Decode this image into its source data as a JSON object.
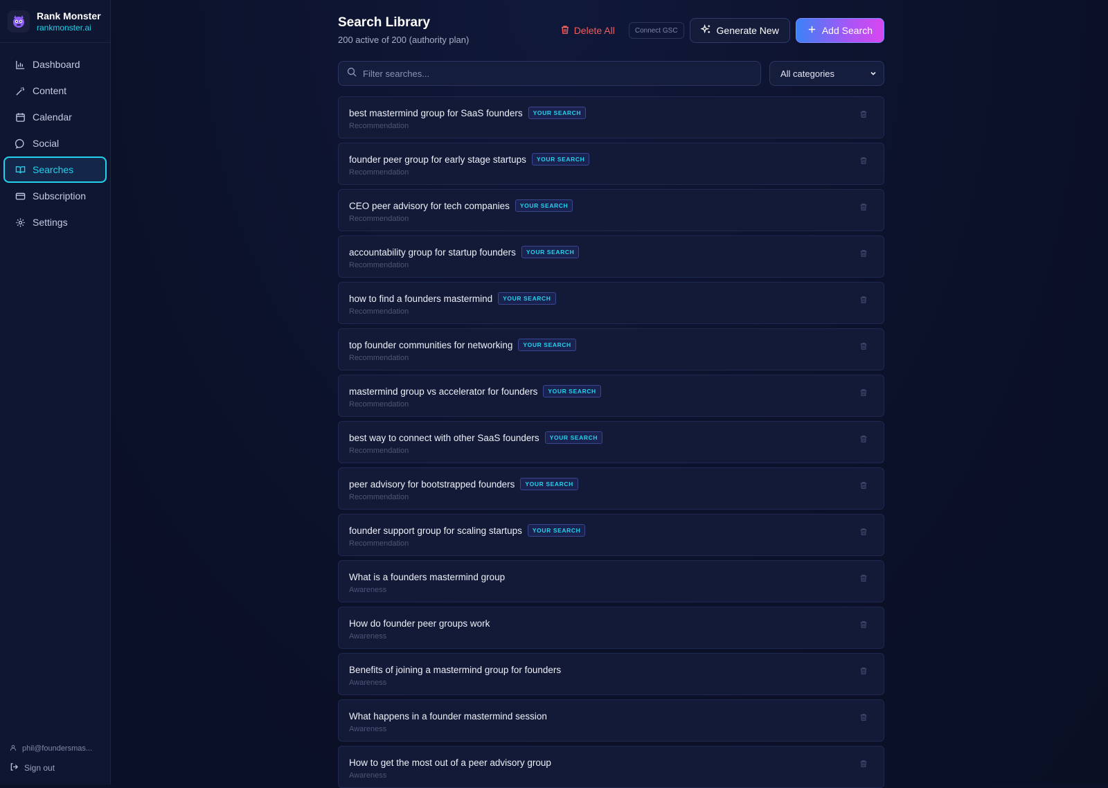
{
  "brand": {
    "name": "Rank Monster",
    "url": "rankmonster.ai",
    "logo_icon": "monster-logo-icon"
  },
  "nav": {
    "items": [
      {
        "label": "Dashboard",
        "icon": "bar-chart-icon",
        "active": false
      },
      {
        "label": "Content",
        "icon": "magic-wand-icon",
        "active": false
      },
      {
        "label": "Calendar",
        "icon": "calendar-icon",
        "active": false
      },
      {
        "label": "Social",
        "icon": "chat-bubble-icon",
        "active": false
      },
      {
        "label": "Searches",
        "icon": "book-icon",
        "active": true
      },
      {
        "label": "Subscription",
        "icon": "credit-card-icon",
        "active": false
      },
      {
        "label": "Settings",
        "icon": "gear-icon",
        "active": false
      }
    ]
  },
  "sidebar_footer": {
    "user_email": "phil@foundersmas...",
    "sign_out": "Sign out"
  },
  "header": {
    "title": "Search Library",
    "subtitle": "200 active of 200 (authority plan)",
    "delete_all": "Delete All",
    "connect_gsc": "Connect GSC",
    "generate_new": "Generate New",
    "add_search": "Add Search"
  },
  "filters": {
    "search_placeholder": "Filter searches...",
    "search_value": "",
    "category_selected": "All categories"
  },
  "badge_label": "YOUR SEARCH",
  "colors": {
    "accent": "#22d3ee",
    "danger": "#f25d5d",
    "background": "#0b1128",
    "card": "#121a37"
  },
  "searches": [
    {
      "title": "best mastermind group for SaaS founders",
      "category": "Recommendation",
      "badge": "YOUR SEARCH"
    },
    {
      "title": "founder peer group for early stage startups",
      "category": "Recommendation",
      "badge": "YOUR SEARCH"
    },
    {
      "title": "CEO peer advisory for tech companies",
      "category": "Recommendation",
      "badge": "YOUR SEARCH"
    },
    {
      "title": "accountability group for startup founders",
      "category": "Recommendation",
      "badge": "YOUR SEARCH"
    },
    {
      "title": "how to find a founders mastermind",
      "category": "Recommendation",
      "badge": "YOUR SEARCH"
    },
    {
      "title": "top founder communities for networking",
      "category": "Recommendation",
      "badge": "YOUR SEARCH"
    },
    {
      "title": "mastermind group vs accelerator for founders",
      "category": "Recommendation",
      "badge": "YOUR SEARCH"
    },
    {
      "title": "best way to connect with other SaaS founders",
      "category": "Recommendation",
      "badge": "YOUR SEARCH"
    },
    {
      "title": "peer advisory for bootstrapped founders",
      "category": "Recommendation",
      "badge": "YOUR SEARCH"
    },
    {
      "title": "founder support group for scaling startups",
      "category": "Recommendation",
      "badge": "YOUR SEARCH"
    },
    {
      "title": "What is a founders mastermind group",
      "category": "Awareness",
      "badge": ""
    },
    {
      "title": "How do founder peer groups work",
      "category": "Awareness",
      "badge": ""
    },
    {
      "title": "Benefits of joining a mastermind group for founders",
      "category": "Awareness",
      "badge": ""
    },
    {
      "title": "What happens in a founder mastermind session",
      "category": "Awareness",
      "badge": ""
    },
    {
      "title": "How to get the most out of a peer advisory group",
      "category": "Awareness",
      "badge": ""
    }
  ]
}
